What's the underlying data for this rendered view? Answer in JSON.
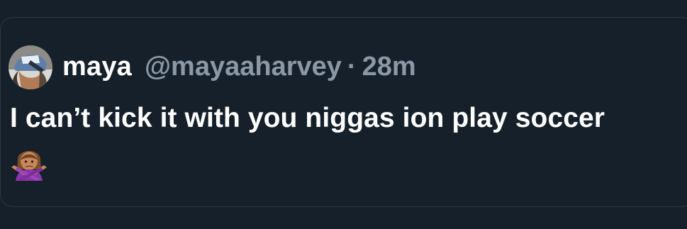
{
  "tweet": {
    "display_name": "maya",
    "handle": "@mayaaharvey",
    "separator": "·",
    "time": "28m",
    "text": "I can’t kick it with you niggas ion play soccer",
    "emoji": "woman-gesturing-no-emoji"
  },
  "colors": {
    "background": "#15202b",
    "primary_text": "#ffffff",
    "secondary_text": "#8b98a5",
    "border": "#2a3845"
  }
}
